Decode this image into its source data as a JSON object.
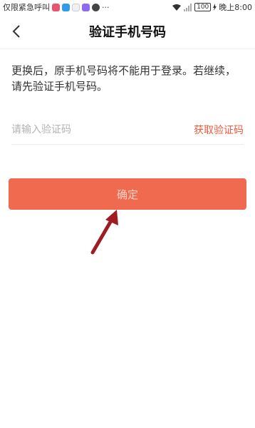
{
  "status_bar": {
    "left_text": "仅限紧急呼叫",
    "more": "···",
    "battery": "100",
    "time": "晚上8:00"
  },
  "nav": {
    "title": "验证手机号码",
    "back_icon": "chevron-left-icon"
  },
  "notice": "更换后，原手机号码将不能用于登录。若继续，请先验证手机号码。",
  "code_input": {
    "placeholder": "请输入验证码",
    "value": ""
  },
  "get_code_label": "获取验证码",
  "confirm_label": "确定",
  "colors": {
    "accent": "#ef5b3d",
    "button_bg": "#f06a4f",
    "button_text": "#ffd3c7",
    "arrow": "#a01c22"
  },
  "annotation": {
    "icon": "arrow-annotation-icon"
  }
}
